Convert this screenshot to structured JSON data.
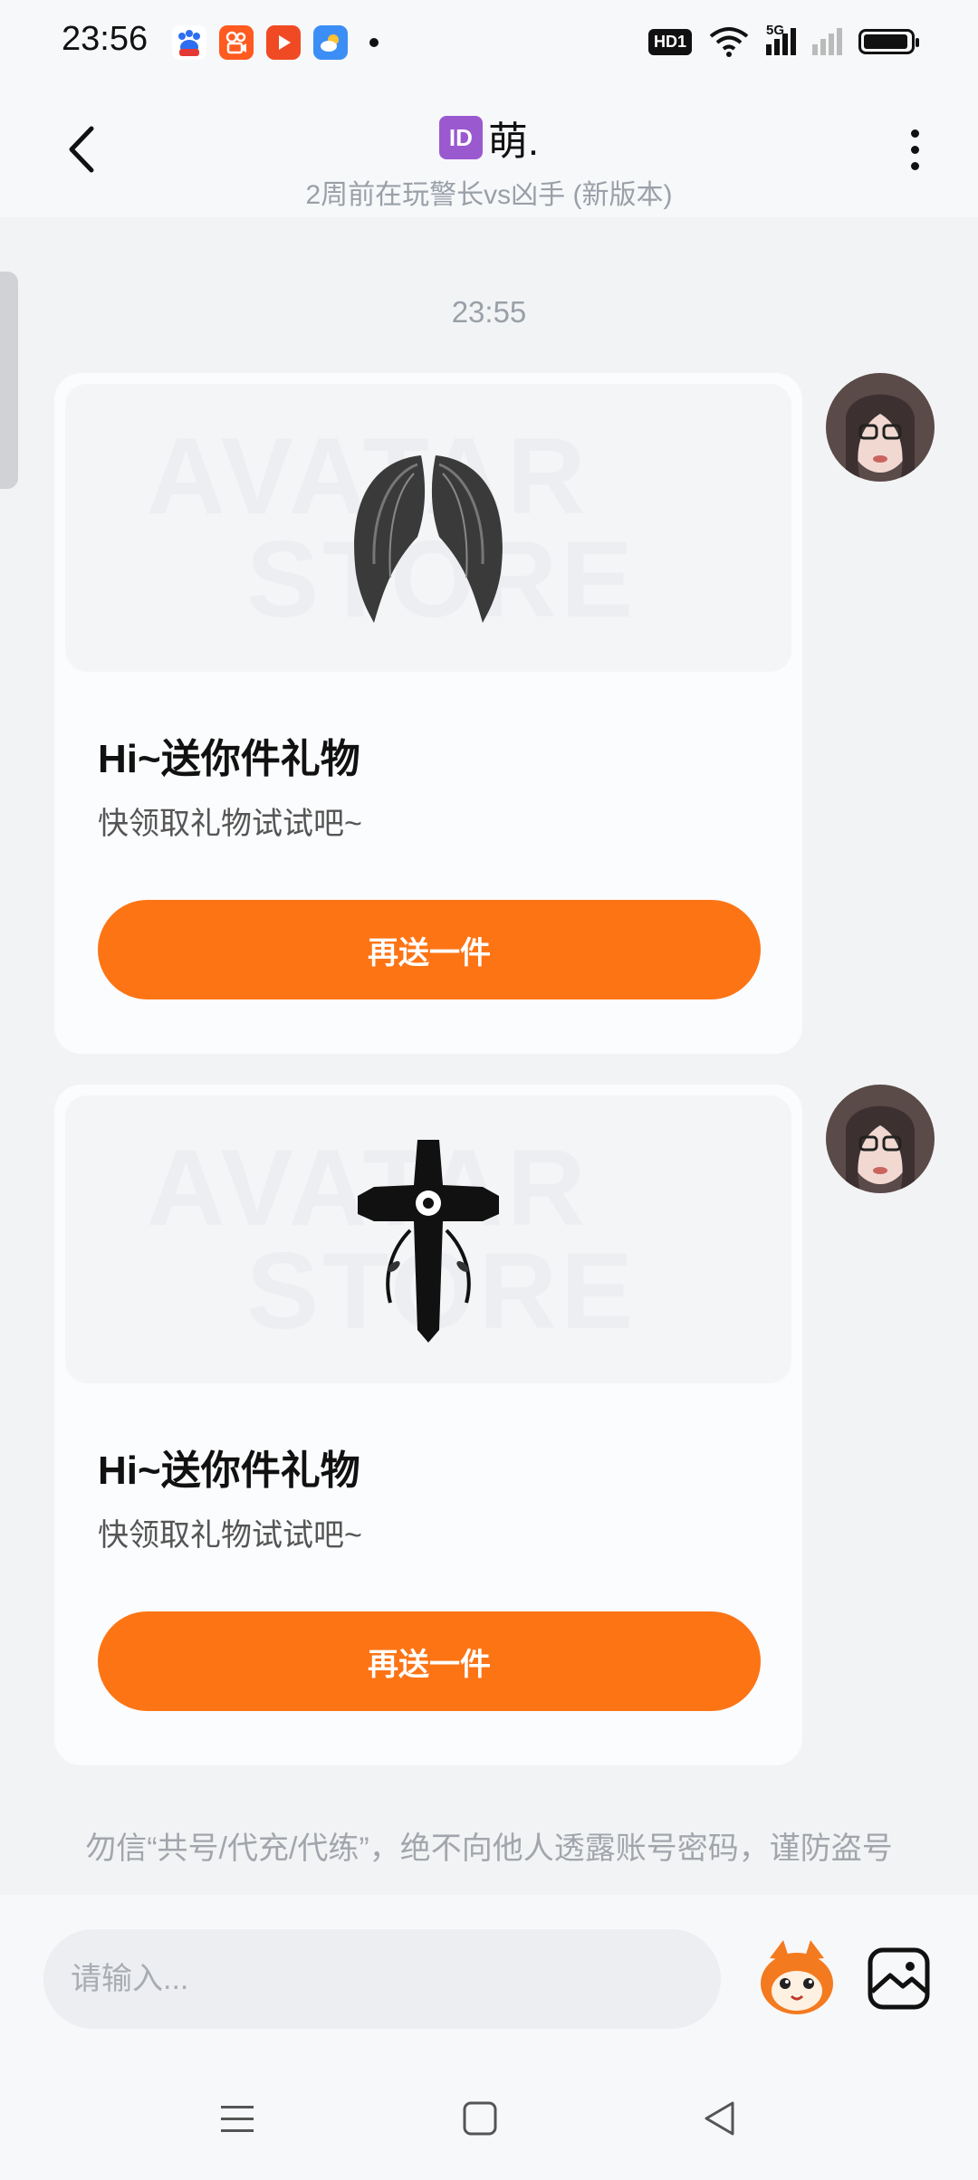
{
  "status_bar": {
    "time": "23:56",
    "app_icons": [
      "baidu-icon",
      "kuaishou-icon",
      "video-icon",
      "weather-icon"
    ],
    "hd_label": "HD1",
    "network_label": "5G"
  },
  "header": {
    "id_badge": "ID",
    "title": "萌.",
    "subtitle": "2周前在玩警长vs凶手 (新版本)"
  },
  "chat": {
    "timestamp": "23:55",
    "messages": [
      {
        "gift_name": "wings",
        "watermark_line1": "AVATAR",
        "watermark_line2": "STORE",
        "title": "Hi~送你件礼物",
        "description": "快领取礼物试试吧~",
        "button_label": "再送一件"
      },
      {
        "gift_name": "cross",
        "watermark_line1": "AVATAR",
        "watermark_line2": "STORE",
        "title": "Hi~送你件礼物",
        "description": "快领取礼物试试吧~",
        "button_label": "再送一件"
      }
    ],
    "notice": "勿信“共号/代充/代练”，绝不向他人透露账号密码，谨防盗号"
  },
  "input_bar": {
    "placeholder": "请输入..."
  },
  "colors": {
    "accent": "#fd7415",
    "background": "#f2f3f5",
    "card": "#fbfcfd"
  }
}
